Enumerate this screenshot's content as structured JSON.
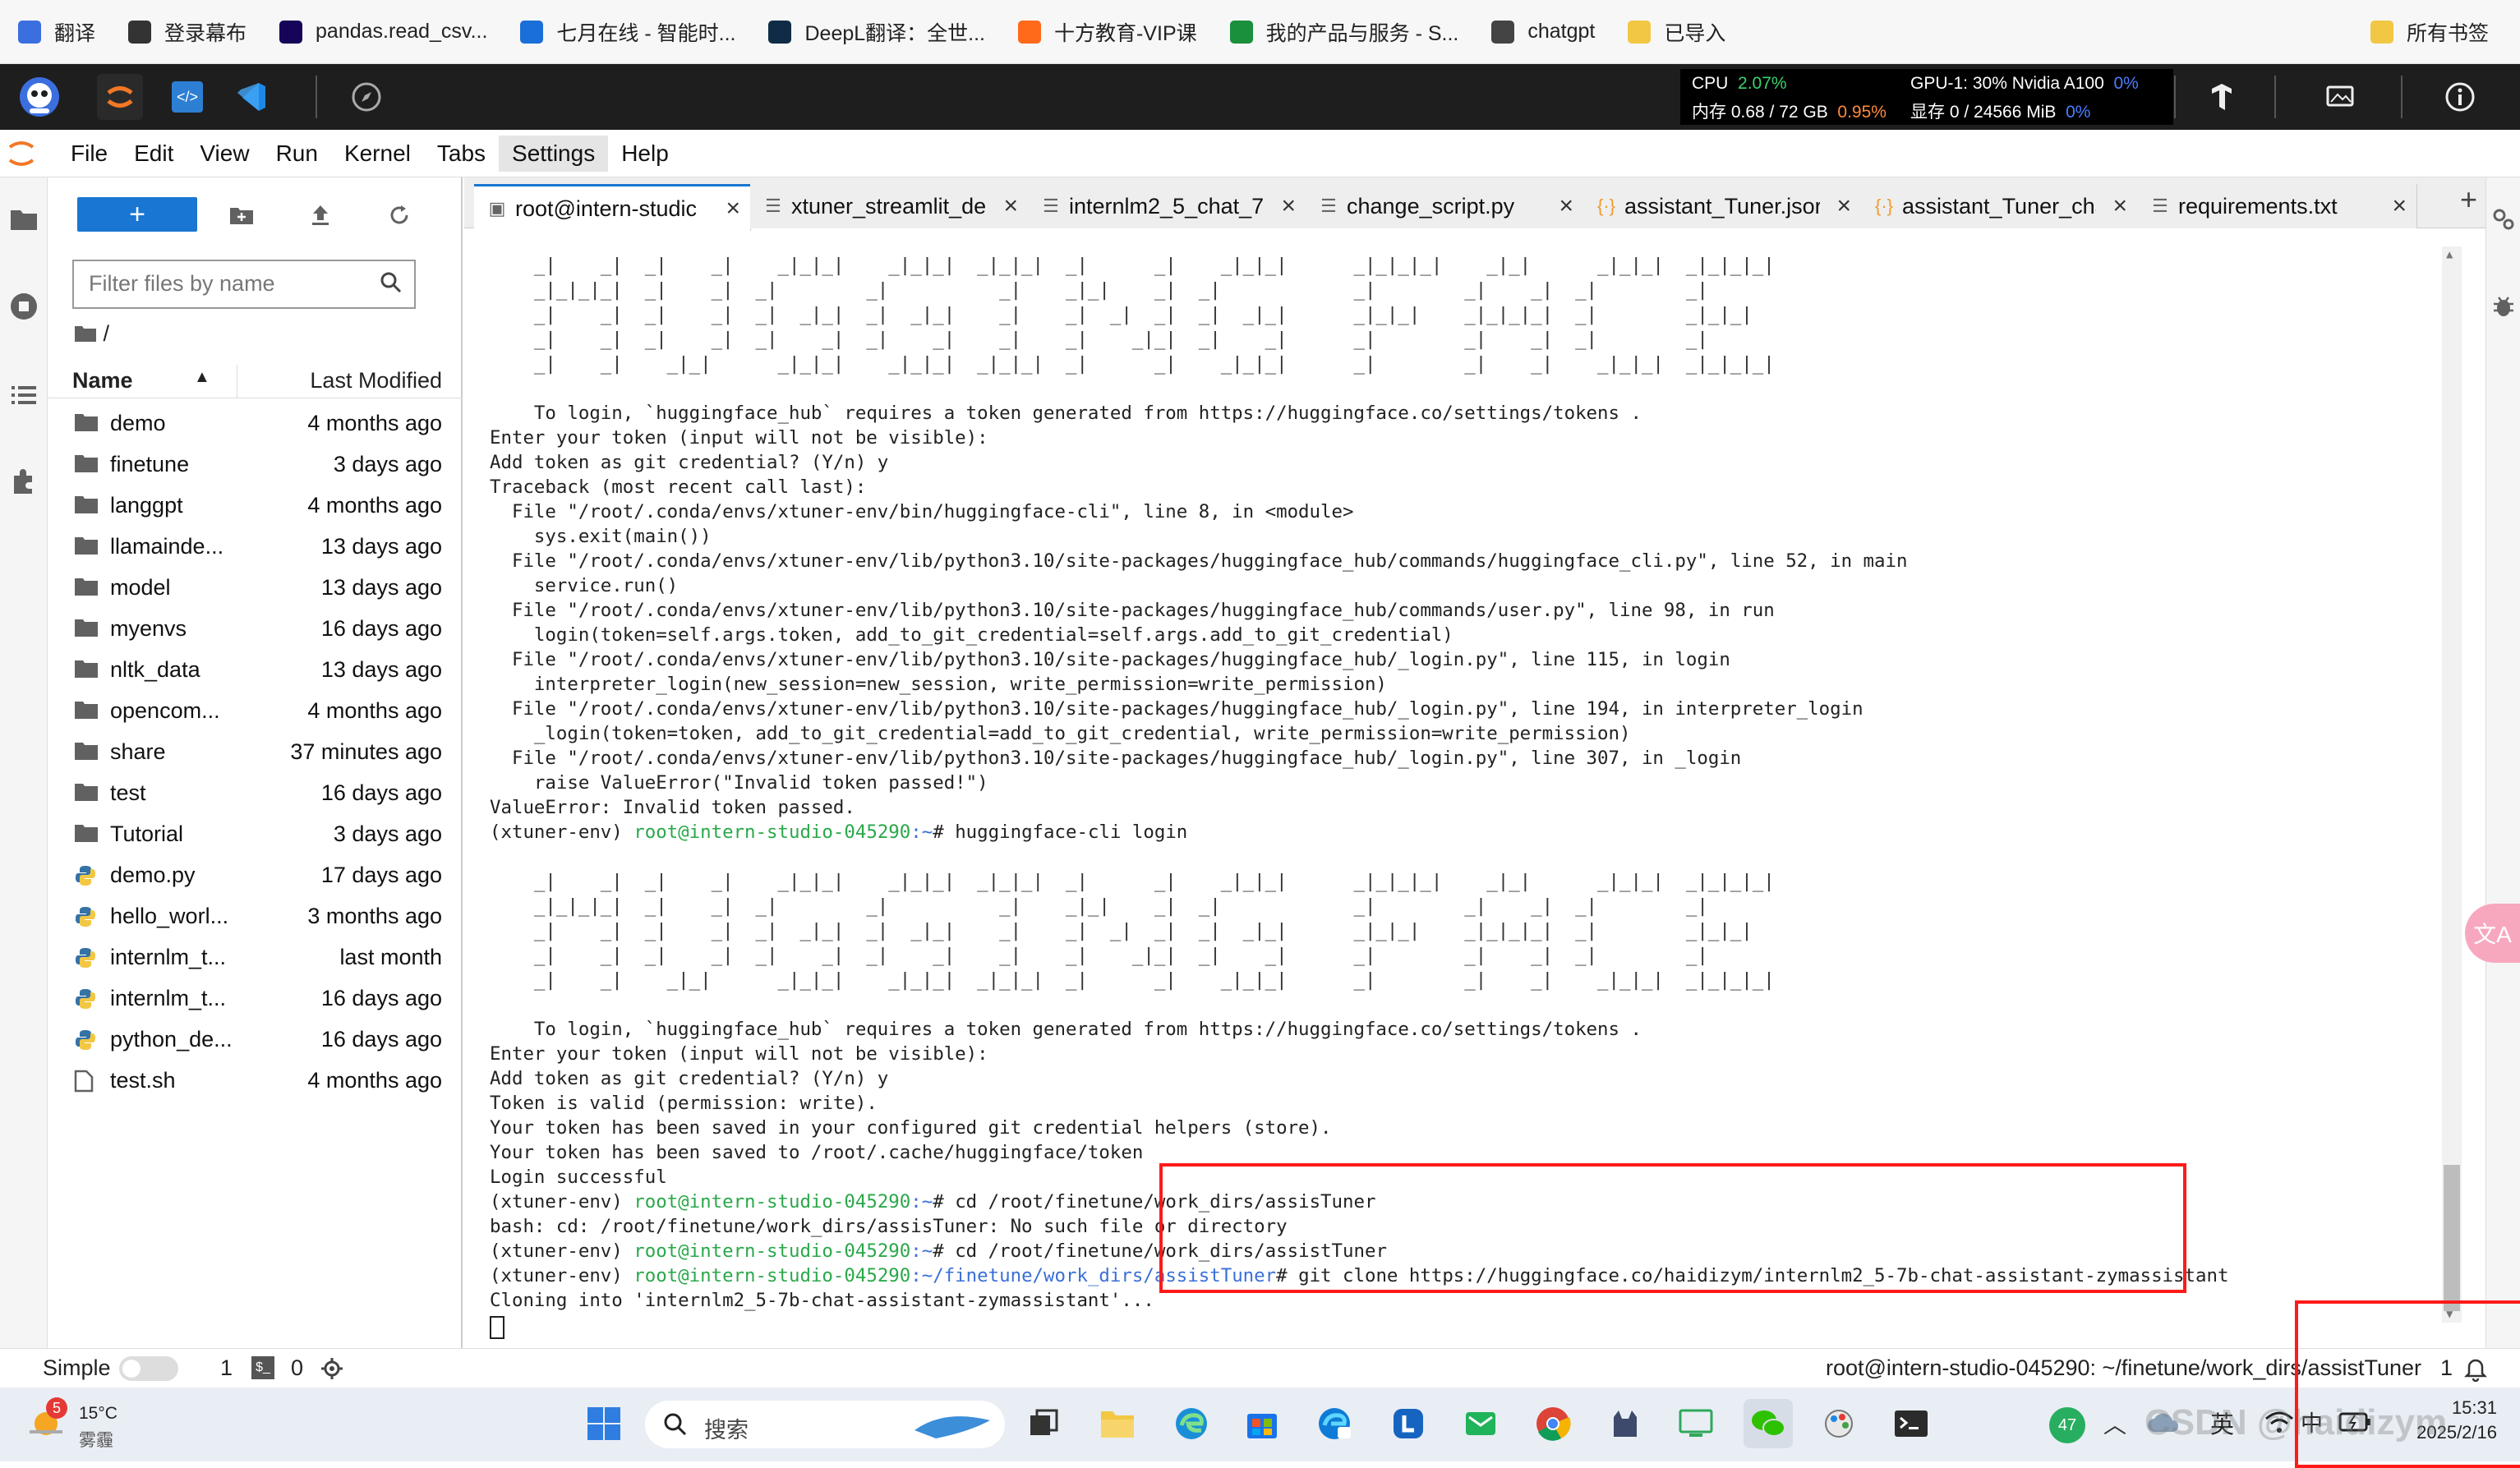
{
  "bookmarks": [
    {
      "label": "翻译",
      "icon": "translate-icon",
      "color": "#3b6fe0"
    },
    {
      "label": "登录幕布",
      "icon": "mubu-icon",
      "color": "#333333"
    },
    {
      "label": "pandas.read_csv...",
      "icon": "pandas-icon",
      "color": "#150458"
    },
    {
      "label": "七月在线 - 智能时...",
      "icon": "julyedu-icon",
      "color": "#1a6fd8"
    },
    {
      "label": "DeepL翻译：全世...",
      "icon": "deepl-icon",
      "color": "#0f2b46"
    },
    {
      "label": "十方教育-VIP课",
      "icon": "shifang-icon",
      "color": "#ff6a1a"
    },
    {
      "label": "我的产品与服务 - S...",
      "icon": "check-icon",
      "color": "#1a8f3c"
    },
    {
      "label": "chatgpt",
      "icon": "openai-icon",
      "color": "#444444"
    },
    {
      "label": "已导入",
      "icon": "folder-icon",
      "color": "#f2c744"
    }
  ],
  "bookmarks_right": "所有书签",
  "resource_monitor": {
    "cpu_label": "CPU",
    "cpu_value": "2.07%",
    "gpu_label": "GPU-1: 30% Nvidia A100",
    "gpu_value": "0%",
    "mem_label": "内存 0.68 / 72 GB",
    "mem_value": "0.95%",
    "vram_label": "显存 0 / 24566 MiB",
    "vram_value": "0%"
  },
  "menu": [
    "File",
    "Edit",
    "View",
    "Run",
    "Kernel",
    "Tabs",
    "Settings",
    "Help"
  ],
  "filebrowser": {
    "new_label": "+",
    "filter_placeholder": "Filter files by name",
    "breadcrumb": "/",
    "col_name": "Name",
    "col_modified": "Last Modified",
    "files": [
      {
        "name": "demo",
        "modified": "4 months ago",
        "type": "folder"
      },
      {
        "name": "finetune",
        "modified": "3 days ago",
        "type": "folder"
      },
      {
        "name": "langgpt",
        "modified": "4 months ago",
        "type": "folder"
      },
      {
        "name": "llamainde...",
        "modified": "13 days ago",
        "type": "folder"
      },
      {
        "name": "model",
        "modified": "13 days ago",
        "type": "folder"
      },
      {
        "name": "myenvs",
        "modified": "16 days ago",
        "type": "folder"
      },
      {
        "name": "nltk_data",
        "modified": "13 days ago",
        "type": "folder"
      },
      {
        "name": "opencom...",
        "modified": "4 months ago",
        "type": "folder"
      },
      {
        "name": "share",
        "modified": "37 minutes ago",
        "type": "folder"
      },
      {
        "name": "test",
        "modified": "16 days ago",
        "type": "folder"
      },
      {
        "name": "Tutorial",
        "modified": "3 days ago",
        "type": "folder"
      },
      {
        "name": "demo.py",
        "modified": "17 days ago",
        "type": "python"
      },
      {
        "name": "hello_worl...",
        "modified": "3 months ago",
        "type": "python"
      },
      {
        "name": "internlm_t...",
        "modified": "last month",
        "type": "python"
      },
      {
        "name": "internlm_t...",
        "modified": "16 days ago",
        "type": "python"
      },
      {
        "name": "python_de...",
        "modified": "16 days ago",
        "type": "python"
      },
      {
        "name": "test.sh",
        "modified": "4 months ago",
        "type": "file"
      }
    ]
  },
  "tabs": [
    {
      "label": "root@intern-studic",
      "icon": "terminal-icon",
      "active": true
    },
    {
      "label": "xtuner_streamlit_de",
      "icon": "text-file-icon",
      "active": false
    },
    {
      "label": "internlm2_5_chat_7",
      "icon": "text-file-icon",
      "active": false
    },
    {
      "label": "change_script.py",
      "icon": "text-file-icon",
      "active": false
    },
    {
      "label": "assistant_Tuner.jsor",
      "icon": "json-icon",
      "active": false
    },
    {
      "label": "assistant_Tuner_cha",
      "icon": "json-icon",
      "active": false
    },
    {
      "label": "requirements.txt",
      "icon": "text-file-icon",
      "active": false
    }
  ],
  "terminal": {
    "banner_rows_1": [
      "    _|    _|  _|    _|    _|_|_|    _|_|_|  _|_|_|  _|      _|    _|_|_|      _|_|_|_|    _|_|      _|_|_|  _|_|_|_|",
      "    _|_|_|_|  _|    _|  _|        _|          _|    _|_|    _|  _|            _|        _|    _|  _|        _|",
      "    _|    _|  _|    _|  _|  _|_|  _|  _|_|    _|    _|  _|  _|  _|  _|_|      _|_|_|    _|_|_|_|  _|        _|_|_|",
      "    _|    _|  _|    _|  _|    _|  _|    _|    _|    _|    _|_|  _|    _|      _|        _|    _|  _|        _|",
      "    _|    _|    _|_|      _|_|_|    _|_|_|  _|_|_|  _|      _|    _|_|_|      _|        _|    _|    _|_|_|  _|_|_|_|"
    ],
    "lines_1": [
      {
        "prefix": "",
        "path": "",
        "text": "    To login, `huggingface_hub` requires a token generated from https://huggingface.co/settings/tokens ."
      },
      {
        "prefix": "",
        "path": "",
        "text": "Enter your token (input will not be visible):"
      },
      {
        "prefix": "",
        "path": "",
        "text": "Add token as git credential? (Y/n) y"
      },
      {
        "prefix": "",
        "path": "",
        "text": "Traceback (most recent call last):"
      },
      {
        "prefix": "",
        "path": "",
        "text": "  File \"/root/.conda/envs/xtuner-env/bin/huggingface-cli\", line 8, in <module>"
      },
      {
        "prefix": "",
        "path": "",
        "text": "    sys.exit(main())"
      },
      {
        "prefix": "",
        "path": "",
        "text": "  File \"/root/.conda/envs/xtuner-env/lib/python3.10/site-packages/huggingface_hub/commands/huggingface_cli.py\", line 52, in main"
      },
      {
        "prefix": "",
        "path": "",
        "text": "    service.run()"
      },
      {
        "prefix": "",
        "path": "",
        "text": "  File \"/root/.conda/envs/xtuner-env/lib/python3.10/site-packages/huggingface_hub/commands/user.py\", line 98, in run"
      },
      {
        "prefix": "",
        "path": "",
        "text": "    login(token=self.args.token, add_to_git_credential=self.args.add_to_git_credential)"
      },
      {
        "prefix": "",
        "path": "",
        "text": "  File \"/root/.conda/envs/xtuner-env/lib/python3.10/site-packages/huggingface_hub/_login.py\", line 115, in login"
      },
      {
        "prefix": "",
        "path": "",
        "text": "    interpreter_login(new_session=new_session, write_permission=write_permission)"
      },
      {
        "prefix": "",
        "path": "",
        "text": "  File \"/root/.conda/envs/xtuner-env/lib/python3.10/site-packages/huggingface_hub/_login.py\", line 194, in interpreter_login"
      },
      {
        "prefix": "",
        "path": "",
        "text": "    _login(token=token, add_to_git_credential=add_to_git_credential, write_permission=write_permission)"
      },
      {
        "prefix": "",
        "path": "",
        "text": "  File \"/root/.conda/envs/xtuner-env/lib/python3.10/site-packages/huggingface_hub/_login.py\", line 307, in _login"
      },
      {
        "prefix": "",
        "path": "",
        "text": "    raise ValueError(\"Invalid token passed!\")"
      },
      {
        "prefix": "",
        "path": "",
        "text": "ValueError: Invalid token passed."
      },
      {
        "prefix": "(xtuner-env) ",
        "user": "root@intern-studio-045290",
        "path": ":~",
        "text": "# huggingface-cli login"
      }
    ],
    "lines_2": [
      {
        "prefix": "",
        "user": "",
        "path": "",
        "text": "    To login, `huggingface_hub` requires a token generated from https://huggingface.co/settings/tokens ."
      },
      {
        "prefix": "",
        "user": "",
        "path": "",
        "text": "Enter your token (input will not be visible):"
      },
      {
        "prefix": "",
        "user": "",
        "path": "",
        "text": "Add token as git credential? (Y/n) y"
      },
      {
        "prefix": "",
        "user": "",
        "path": "",
        "text": "Token is valid (permission: write)."
      },
      {
        "prefix": "",
        "user": "",
        "path": "",
        "text": "Your token has been saved in your configured git credential helpers (store)."
      },
      {
        "prefix": "",
        "user": "",
        "path": "",
        "text": "Your token has been saved to /root/.cache/huggingface/token"
      },
      {
        "prefix": "",
        "user": "",
        "path": "",
        "text": "Login successful"
      },
      {
        "prefix": "(xtuner-env) ",
        "user": "root@intern-studio-045290",
        "path": ":~",
        "text": "# cd /root/finetune/work_dirs/assisTuner"
      },
      {
        "prefix": "",
        "user": "",
        "path": "",
        "text": "bash: cd: /root/finetune/work_dirs/assisTuner: No such file or directory"
      },
      {
        "prefix": "(xtuner-env) ",
        "user": "root@intern-studio-045290",
        "path": ":~",
        "text": "# cd /root/finetune/work_dirs/assistTuner"
      },
      {
        "prefix": "(xtuner-env) ",
        "user": "root@intern-studio-045290",
        "path": ":~/finetune/work_dirs/assistTuner",
        "text": "# git clone https://huggingface.co/haidizym/internlm2_5-7b-chat-assistant-zymassistant"
      },
      {
        "prefix": "",
        "user": "",
        "path": "",
        "text": "Cloning into 'internlm2_5-7b-chat-assistant-zymassistant'..."
      }
    ]
  },
  "statusbar": {
    "mode_label": "Simple",
    "terminals_count": "1",
    "kernels_count": "0",
    "right_text": "root@intern-studio-045290: ~/finetune/work_dirs/assistTuner",
    "right_count": "1"
  },
  "taskbar": {
    "weather_temp": "15°C",
    "weather_desc": "雾霾",
    "weather_badge": "5",
    "search_label": "搜索",
    "tray_badge": "47",
    "ime_label": "英",
    "ime_mode": "中",
    "time": "15:31",
    "date": "2025/2/16",
    "watermark": "CSDN @haidizym"
  }
}
